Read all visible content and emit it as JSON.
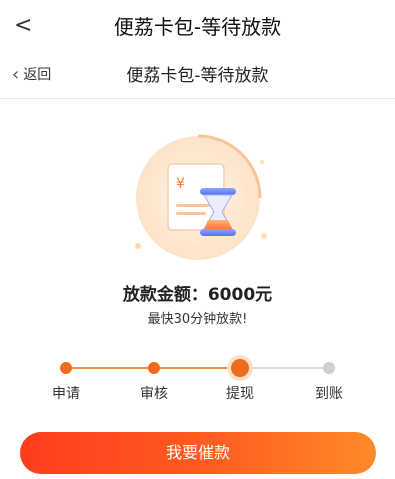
{
  "header": {
    "back_glyph": "<",
    "title": "便荔卡包-等待放款"
  },
  "subheader": {
    "back_label": "返回",
    "title": "便荔卡包-等待放款"
  },
  "illustration": {
    "currency_symbol": "¥"
  },
  "loan": {
    "amount_text": "放款金额：6000元",
    "note": "最快30分钟放款!"
  },
  "progress": {
    "current_step_index": 2,
    "steps": [
      {
        "label": "申请",
        "state": "done"
      },
      {
        "label": "审核",
        "state": "done"
      },
      {
        "label": "提现",
        "state": "current"
      },
      {
        "label": "到账",
        "state": "pending"
      }
    ]
  },
  "actions": {
    "urge_button": "我要催款"
  },
  "colors": {
    "accent": "#ef6b1d",
    "button_gradient_start": "#ff3d1f",
    "button_gradient_end": "#ff8a2a",
    "pending": "#cfcfcf"
  }
}
